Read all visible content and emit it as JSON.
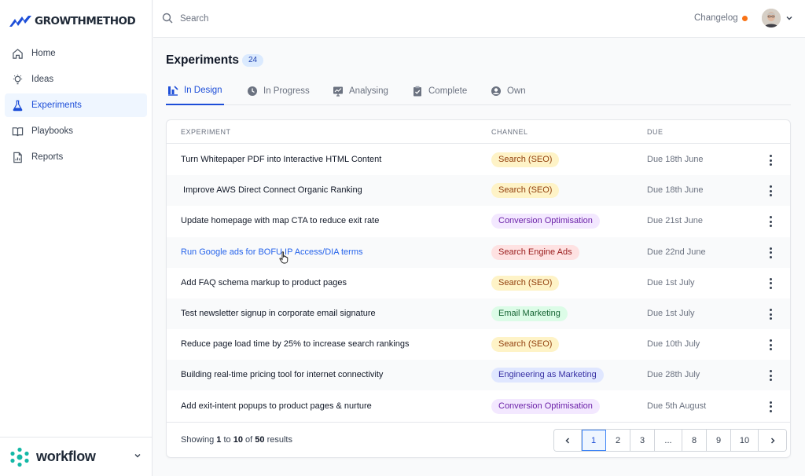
{
  "app": {
    "logo_text": "GROWTHMETHOD",
    "brand_color": "#1d4ed8"
  },
  "sidebar": {
    "items": [
      {
        "label": "Home",
        "icon": "home-icon"
      },
      {
        "label": "Ideas",
        "icon": "lightbulb-icon"
      },
      {
        "label": "Experiments",
        "icon": "flask-icon",
        "active": true
      },
      {
        "label": "Playbooks",
        "icon": "book-icon"
      },
      {
        "label": "Reports",
        "icon": "report-icon"
      }
    ],
    "workspace": {
      "name": "workflow",
      "icon": "workflow-logo-icon"
    }
  },
  "topbar": {
    "search_placeholder": "Search",
    "changelog_label": "Changelog",
    "changelog_dot_color": "#f97316"
  },
  "page": {
    "title": "Experiments",
    "count": "24"
  },
  "tabs": [
    {
      "label": "In Design",
      "icon": "chart-icon",
      "active": true
    },
    {
      "label": "In Progress",
      "icon": "clock-icon"
    },
    {
      "label": "Analysing",
      "icon": "analytics-icon"
    },
    {
      "label": "Complete",
      "icon": "clipboard-check-icon"
    },
    {
      "label": "Own",
      "icon": "user-circle-icon"
    }
  ],
  "table": {
    "headers": {
      "experiment": "EXPERIMENT",
      "channel": "CHANNEL",
      "due": "DUE"
    },
    "rows": [
      {
        "name": "Turn Whitepaper PDF into Interactive HTML Content",
        "channel": "Search (SEO)",
        "due": "Due 18th June"
      },
      {
        "name": " Improve AWS Direct Connect Organic Ranking",
        "channel": "Search (SEO)",
        "due": "Due 18th June"
      },
      {
        "name": "Update homepage with map CTA to reduce exit rate",
        "channel": "Conversion Optimisation",
        "due": "Due 21st June"
      },
      {
        "name": "Run Google ads for BOFU IP Access/DIA terms",
        "channel": "Search Engine Ads",
        "due": "Due 22nd June",
        "hovered": true
      },
      {
        "name": "Add FAQ schema markup to product pages",
        "channel": "Search (SEO)",
        "due": "Due 1st July"
      },
      {
        "name": "Test newsletter signup in corporate email signature",
        "channel": "Email Marketing",
        "due": "Due 1st July"
      },
      {
        "name": "Reduce page load time by 25% to increase search rankings",
        "channel": "Search (SEO)",
        "due": "Due 10th July"
      },
      {
        "name": "Building real-time pricing tool for internet connectivity",
        "channel": "Engineering as Marketing",
        "due": "Due 28th July"
      },
      {
        "name": "Add exit-intent popups to product pages & nurture",
        "channel": "Conversion Optimisation",
        "due": "Due 5th August"
      }
    ],
    "channel_colors": {
      "Search (SEO)": {
        "bg": "#fef3c7",
        "fg": "#92400e"
      },
      "Conversion Optimisation": {
        "bg": "#f3e8ff",
        "fg": "#6b21a8"
      },
      "Search Engine Ads": {
        "bg": "#fee2e2",
        "fg": "#991b1b"
      },
      "Email Marketing": {
        "bg": "#dcfce7",
        "fg": "#166534"
      },
      "Engineering as Marketing": {
        "bg": "#e0e7ff",
        "fg": "#3730a3"
      }
    }
  },
  "pagination": {
    "showing_prefix": "Showing",
    "from": "1",
    "to_word": "to",
    "to": "10",
    "of_word": "of",
    "total": "50",
    "results_word": "results",
    "pages": [
      "1",
      "2",
      "3",
      "...",
      "8",
      "9",
      "10"
    ],
    "current": "1"
  }
}
